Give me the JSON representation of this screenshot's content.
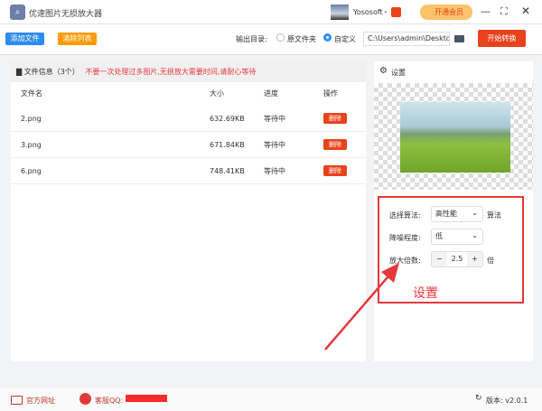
{
  "app": {
    "title": "优速图片无损放大器",
    "user": "Yososoft",
    "vip": "开通会员"
  },
  "toolbar": {
    "add": "添加文件",
    "clear": "清除列表",
    "output_label": "输出目录:",
    "opt_original": "原文件夹",
    "opt_custom": "自定义",
    "path": "C:\\Users\\admin\\Deskto",
    "start": "开始转换"
  },
  "files": {
    "header": "文件信息（3个）",
    "warning": "不要一次处理过多图片,无损放大需要时间,请耐心等待",
    "columns": {
      "name": "文件名",
      "size": "大小",
      "progress": "进度",
      "action": "操作"
    },
    "rows": [
      {
        "name": "2.png",
        "size": "632.69KB",
        "status": "等待中",
        "action": "删除"
      },
      {
        "name": "3.png",
        "size": "671.84KB",
        "status": "等待中",
        "action": "删除"
      },
      {
        "name": "6.png",
        "size": "748.41KB",
        "status": "等待中",
        "action": "删除"
      }
    ]
  },
  "settings": {
    "title": "设置",
    "algo_label": "选择算法:",
    "algo_value": "高性能",
    "algo_suffix": "算法",
    "noise_label": "降噪程度:",
    "noise_value": "低",
    "scale_label": "放大倍数:",
    "scale_value": "2.5",
    "scale_suffix": "倍",
    "annotation": "设置"
  },
  "footer": {
    "website": "官方网址",
    "support": "客服QQ:",
    "version": "版本: v2.0.1"
  },
  "colors": {
    "accent": "#e8431b",
    "blue": "#2d8cf0",
    "orange": "#ff9c00"
  }
}
